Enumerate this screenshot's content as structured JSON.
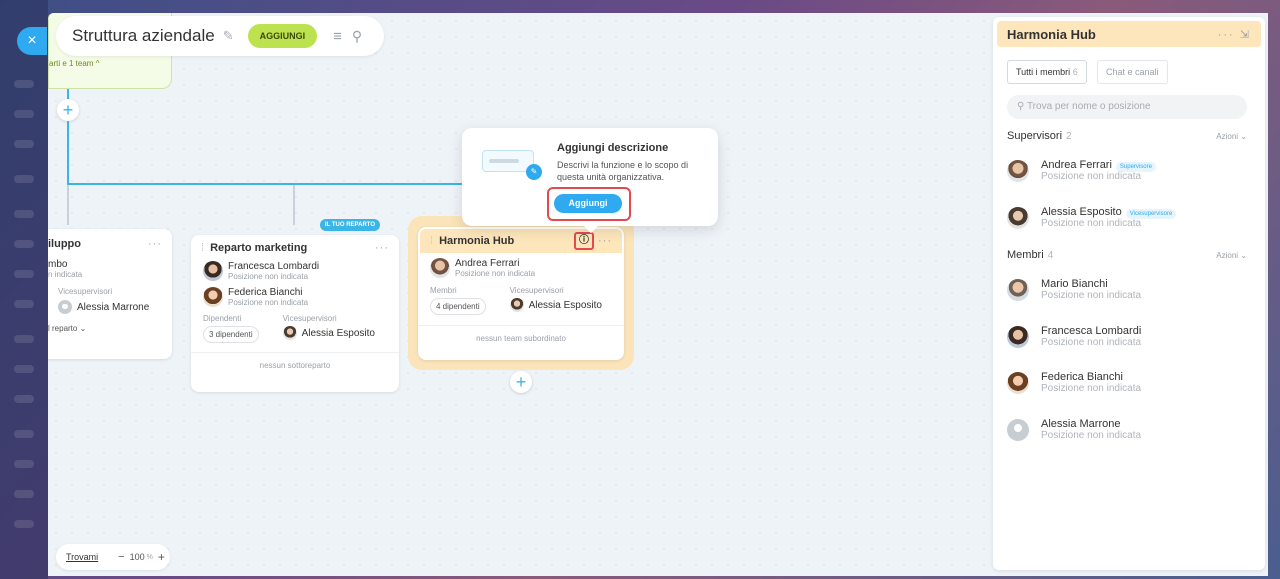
{
  "app": {
    "close_glyph": "×"
  },
  "topbar": {
    "title": "Struttura aziendale",
    "add_label": "AGGIUNGI"
  },
  "parent": {
    "label": "arti e 1 team ^"
  },
  "cards": {
    "sviluppo": {
      "title": "iluppo",
      "person_name": "mbo",
      "person_sub": "n indicata",
      "deputy_cap": "Vicesupervisori",
      "deputy_name": "Alessia Marrone",
      "expand_label": "l reparto ⌄"
    },
    "marketing": {
      "title": "Reparto marketing",
      "members": [
        {
          "name": "Francesca Lombardi",
          "sub": "Posizione non indicata"
        },
        {
          "name": "Federica Bianchi",
          "sub": "Posizione non indicata"
        }
      ],
      "employees_cap": "Dipendenti",
      "employees_chip": "3 dipendenti",
      "deputy_cap": "Vicesupervisori",
      "deputy_name": "Alessia Esposito",
      "footer": "nessun sottoreparto"
    },
    "harmonia": {
      "badge": "IL TUO REPARTO",
      "title": "Harmonia Hub",
      "member": {
        "name": "Andrea Ferrari",
        "sub": "Posizione non indicata"
      },
      "members_cap": "Membri",
      "members_chip": "4 dipendenti",
      "deputy_cap": "Vicesupervisori",
      "deputy_name": "Alessia Esposito",
      "footer": "nessun team subordinato"
    }
  },
  "popover": {
    "title": "Aggiungi descrizione",
    "desc": "Descrivi la funzione e lo scopo di questa unità organizzativa.",
    "button": "Aggiungi"
  },
  "zoom": {
    "find_label": "Trovami",
    "minus": "−",
    "level": "100",
    "unit": "%",
    "plus": "+"
  },
  "panel": {
    "title": "Harmonia Hub",
    "tab_all": "Tutti i membri",
    "tab_all_count": "6",
    "tab_chat": "Chat e canali",
    "search_placeholder": "Trova per nome o posizione",
    "supervisors_title": "Supervisori",
    "supervisors_count": "2",
    "actions_label": "Azioni ⌄",
    "supervisors": [
      {
        "name": "Andrea Ferrari",
        "tag": "Supervisore",
        "sub": "Posizione non indicata"
      },
      {
        "name": "Alessia Esposito",
        "tag": "Vicesupervisore",
        "sub": "Posizione non indicata"
      }
    ],
    "members_title": "Membri",
    "members_count": "4",
    "members": [
      {
        "name": "Mario Bianchi",
        "sub": "Posizione non indicata"
      },
      {
        "name": "Francesca Lombardi",
        "sub": "Posizione non indicata"
      },
      {
        "name": "Federica Bianchi",
        "sub": "Posizione non indicata"
      },
      {
        "name": "Alessia Marrone",
        "sub": "Posizione non indicata"
      }
    ]
  },
  "colors": {
    "accent": "#2fa9f0",
    "highlight": "#e5484d",
    "lime": "#bde24f",
    "panel_head": "#fde6bb"
  }
}
